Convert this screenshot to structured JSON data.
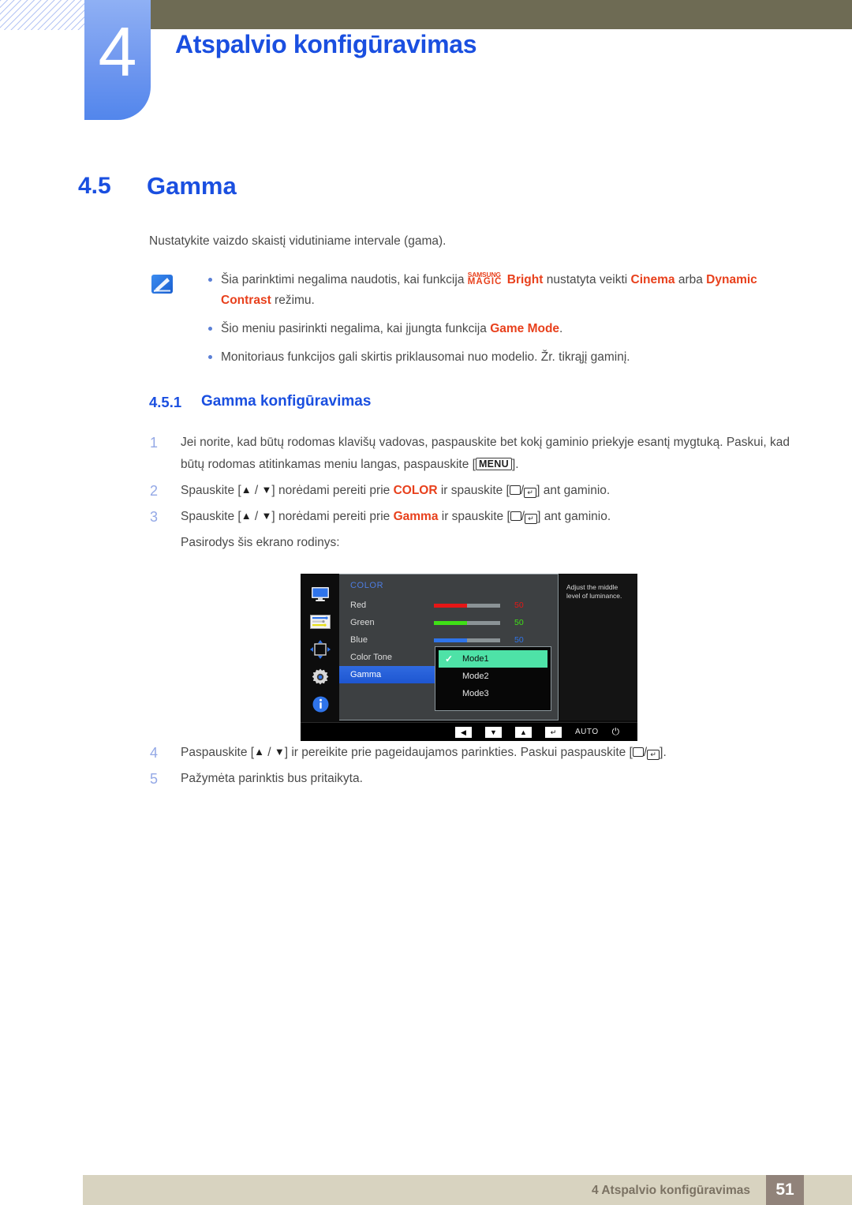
{
  "header": {
    "chapter_number": "4",
    "chapter_title": "Atspalvio konfigūravimas"
  },
  "section": {
    "number": "4.5",
    "title": "Gamma"
  },
  "intro": "Nustatykite vaizdo skaistį vidutiniame intervale (gama).",
  "note": {
    "icon": "note-pencil-icon",
    "bullets": [
      {
        "parts": [
          {
            "t": "Šia parinktimi negalima naudotis, kai funkcija ",
            "s": "plain"
          },
          {
            "t": "MAGIC",
            "s": "magic"
          },
          {
            "t": "Bright",
            "s": "red-bold"
          },
          {
            "t": " nustatyta veikti ",
            "s": "plain"
          },
          {
            "t": "Cinema",
            "s": "red-bold"
          },
          {
            "t": " arba ",
            "s": "plain"
          },
          {
            "t": "Dynamic Contrast",
            "s": "red-bold"
          },
          {
            "t": " režimu.",
            "s": "plain"
          }
        ]
      },
      {
        "parts": [
          {
            "t": "Šio meniu pasirinkti negalima, kai įjungta funkcija ",
            "s": "plain"
          },
          {
            "t": "Game Mode",
            "s": "red-bold"
          },
          {
            "t": ".",
            "s": "plain"
          }
        ]
      },
      {
        "parts": [
          {
            "t": "Monitoriaus funkcijos gali skirtis priklausomai nuo modelio. Žr. tikrąjį gaminį.",
            "s": "plain"
          }
        ]
      }
    ],
    "magic_top": "SAMSUNG",
    "magic_bottom": "MAGIC"
  },
  "subsection": {
    "number": "4.5.1",
    "title": "Gamma konfigūravimas"
  },
  "steps": [
    {
      "n": "1",
      "parts": [
        {
          "t": "Jei norite, kad būtų rodomas klavišų vadovas, paspauskite bet kokį gaminio priekyje esantį mygtuką. Paskui, kad būtų rodomas atitinkamas meniu langas, paspauskite [",
          "s": "plain"
        },
        {
          "t": "MENU",
          "s": "keycap"
        },
        {
          "t": "].",
          "s": "plain"
        }
      ]
    },
    {
      "n": "2",
      "parts": [
        {
          "t": "Spauskite [",
          "s": "plain"
        },
        {
          "t": "▲",
          "s": "tri"
        },
        {
          "t": " / ",
          "s": "plain"
        },
        {
          "t": "▼",
          "s": "tri"
        },
        {
          "t": "] norėdami pereiti prie ",
          "s": "plain"
        },
        {
          "t": "COLOR",
          "s": "red-bold"
        },
        {
          "t": " ir spauskite [",
          "s": "plain"
        },
        {
          "t": "",
          "s": "sq"
        },
        {
          "t": "/",
          "s": "plain"
        },
        {
          "t": "",
          "s": "ent"
        },
        {
          "t": "] ant gaminio.",
          "s": "plain"
        }
      ]
    },
    {
      "n": "3",
      "parts": [
        {
          "t": "Spauskite [",
          "s": "plain"
        },
        {
          "t": "▲",
          "s": "tri"
        },
        {
          "t": " / ",
          "s": "plain"
        },
        {
          "t": "▼",
          "s": "tri"
        },
        {
          "t": "] norėdami pereiti prie ",
          "s": "plain"
        },
        {
          "t": "Gamma",
          "s": "red-bold"
        },
        {
          "t": " ir spauskite [",
          "s": "plain"
        },
        {
          "t": "",
          "s": "sq"
        },
        {
          "t": "/",
          "s": "plain"
        },
        {
          "t": "",
          "s": "ent"
        },
        {
          "t": "] ant gaminio.",
          "s": "plain"
        }
      ]
    }
  ],
  "after_step3": "Pasirodys šis ekrano rodinys:",
  "steps_after": [
    {
      "n": "4",
      "parts": [
        {
          "t": "Paspauskite [",
          "s": "plain"
        },
        {
          "t": "▲",
          "s": "tri"
        },
        {
          "t": " / ",
          "s": "plain"
        },
        {
          "t": "▼",
          "s": "tri"
        },
        {
          "t": "] ir pereikite prie pageidaujamos parinkties. Paskui paspauskite [",
          "s": "plain"
        },
        {
          "t": "",
          "s": "sq"
        },
        {
          "t": "/",
          "s": "plain"
        },
        {
          "t": "",
          "s": "ent"
        },
        {
          "t": "].",
          "s": "plain"
        }
      ]
    },
    {
      "n": "5",
      "parts": [
        {
          "t": "Pažymėta parinktis bus pritaikyta.",
          "s": "plain"
        }
      ]
    }
  ],
  "osd": {
    "menu_title": "COLOR",
    "sidebar_icons": [
      "monitor-icon",
      "picture-sliders-icon",
      "position-arrows-icon",
      "gear-icon",
      "info-icon"
    ],
    "items": [
      {
        "label": "Red",
        "value": "50",
        "color": "#e61616",
        "bar": true,
        "selected": false
      },
      {
        "label": "Green",
        "value": "50",
        "color": "#3fe016",
        "bar": true,
        "selected": false
      },
      {
        "label": "Blue",
        "value": "50",
        "color": "#2f74ea",
        "bar": true,
        "selected": false
      },
      {
        "label": "Color Tone",
        "value": "",
        "color": "",
        "bar": false,
        "selected": false
      },
      {
        "label": "Gamma",
        "value": "",
        "color": "",
        "bar": false,
        "selected": true
      }
    ],
    "dropdown": [
      {
        "label": "Mode1",
        "selected": true
      },
      {
        "label": "Mode2",
        "selected": false
      },
      {
        "label": "Mode3",
        "selected": false
      }
    ],
    "help_text": "Adjust the middle level of luminance.",
    "footer_buttons": [
      "◀",
      "▼",
      "▲",
      "↵"
    ],
    "footer_auto": "AUTO",
    "footer_power": "⏻"
  },
  "footer": {
    "text": "4 Atspalvio konfigūravimas",
    "page": "51"
  },
  "colors": {
    "brand_blue": "#1a4fe0",
    "accent_red": "#e8401c",
    "olive": "#6e6b54",
    "footer_beige": "#d8d3c0",
    "footer_page_bg": "#91837a"
  }
}
